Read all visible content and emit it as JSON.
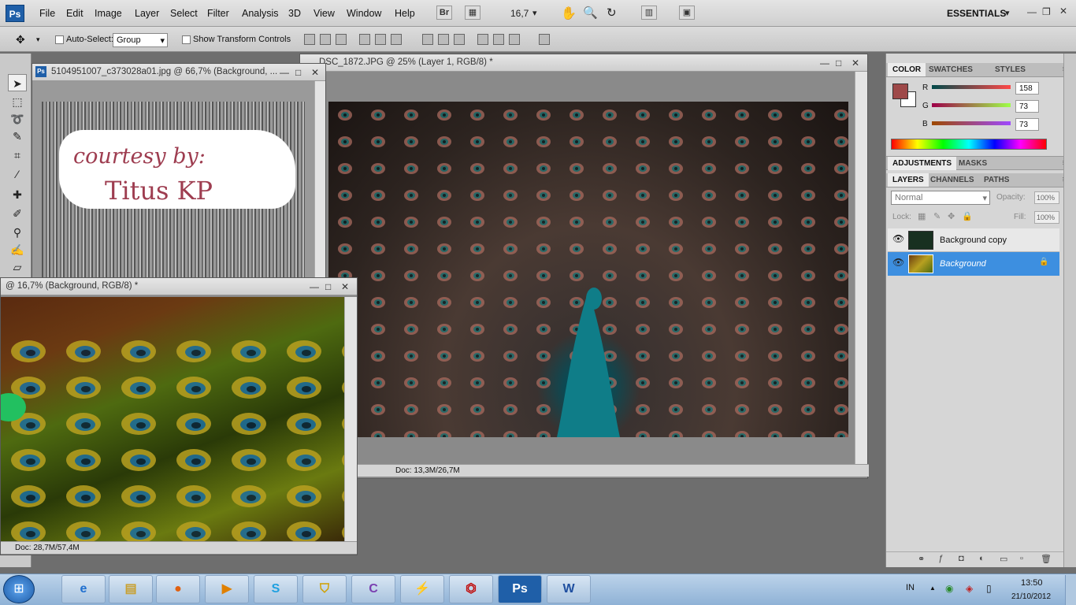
{
  "app": {
    "logo": "Ps",
    "menu": [
      "File",
      "Edit",
      "Image",
      "Layer",
      "Select",
      "Filter",
      "Analysis",
      "3D",
      "View",
      "Window",
      "Help"
    ],
    "bridge": "Br",
    "zoom": "16,7",
    "workspace": "ESSENTIALS"
  },
  "options": {
    "auto_select_label": "Auto-Select:",
    "auto_select_value": "Group",
    "show_transform_label": "Show Transform Controls"
  },
  "windows": {
    "doc1": {
      "title": "5104951007_c373028a01.jpg @ 66,7% (Background, ...",
      "courtesy": "courtesy by:",
      "author": "Titus KP"
    },
    "doc2": {
      "title": "DSC_1872.JPG @ 25% (Layer 1, RGB/8) *",
      "status": "Doc: 13,3M/26,7M"
    },
    "doc3": {
      "title": "@ 16,7% (Background, RGB/8) *",
      "status": "Doc: 28,7M/57,4M"
    }
  },
  "color_panel": {
    "tabs": [
      "COLOR",
      "SWATCHES",
      "STYLES"
    ],
    "r_label": "R",
    "r": "158",
    "g_label": "G",
    "g": "73",
    "b_label": "B",
    "b": "73",
    "fg": "#9e4949"
  },
  "adj_panel": {
    "tabs": [
      "ADJUSTMENTS",
      "MASKS"
    ]
  },
  "layers_panel": {
    "tabs": [
      "LAYERS",
      "CHANNELS",
      "PATHS"
    ],
    "blend": "Normal",
    "opacity_label": "Opacity:",
    "opacity": "100%",
    "lock_label": "Lock:",
    "fill_label": "Fill:",
    "fill": "100%",
    "layers": [
      {
        "name": "Background copy"
      },
      {
        "name": "Background"
      }
    ]
  },
  "taskbar": {
    "lang": "IN",
    "time": "13:50",
    "date": "21/10/2012"
  }
}
